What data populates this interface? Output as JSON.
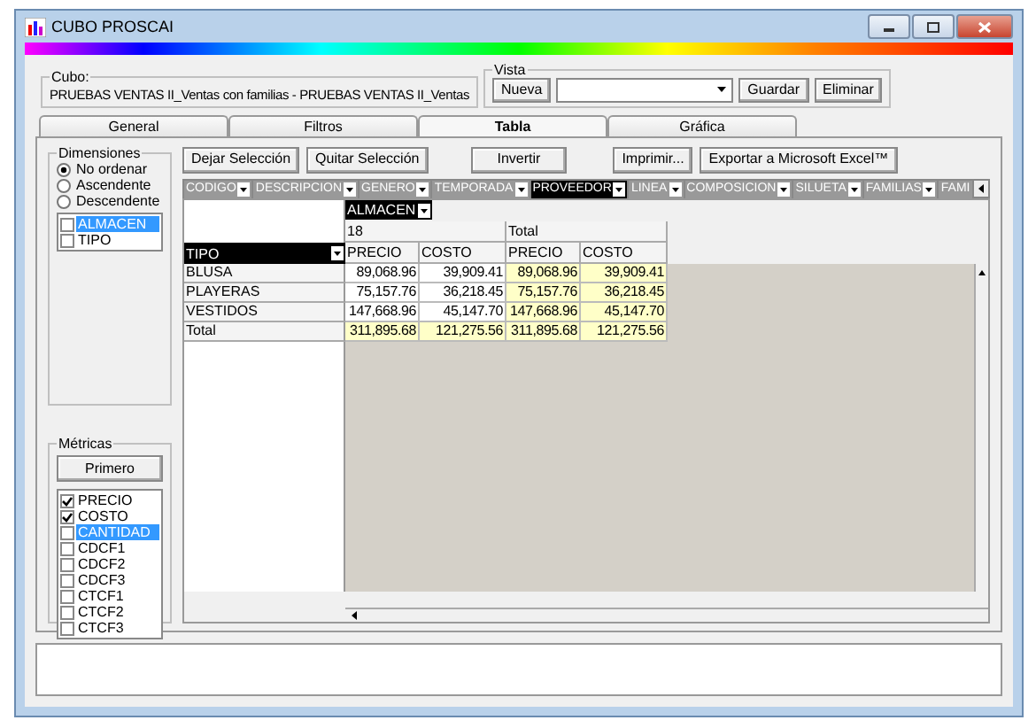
{
  "window": {
    "title": "CUBO PROSCAI"
  },
  "cube": {
    "label": "Cubo:",
    "value": "PRUEBAS VENTAS II_Ventas con familias - PRUEBAS VENTAS II_Ventas"
  },
  "view": {
    "label": "Vista",
    "new_button": "Nueva",
    "save_button": "Guardar",
    "delete_button": "Eliminar"
  },
  "tabs": [
    {
      "label": "General",
      "selected": false
    },
    {
      "label": "Filtros",
      "selected": false
    },
    {
      "label": "Tabla",
      "selected": true
    },
    {
      "label": "Gráfica",
      "selected": false
    }
  ],
  "dimensions": {
    "label": "Dimensiones",
    "sort_options": [
      {
        "label": "No ordenar",
        "selected": true
      },
      {
        "label": "Ascendente",
        "selected": false
      },
      {
        "label": "Descendente",
        "selected": false
      }
    ],
    "items": [
      {
        "label": "ALMACEN",
        "checked": false,
        "selected": true
      },
      {
        "label": "TIPO",
        "checked": false,
        "selected": false
      }
    ]
  },
  "metrics": {
    "label": "Métricas",
    "button": "Primero",
    "items": [
      {
        "label": "PRECIO",
        "checked": true,
        "selected": false
      },
      {
        "label": "COSTO",
        "checked": true,
        "selected": false
      },
      {
        "label": "CANTIDAD",
        "checked": false,
        "selected": true
      },
      {
        "label": "CDCF1",
        "checked": false,
        "selected": false
      },
      {
        "label": "CDCF2",
        "checked": false,
        "selected": false
      },
      {
        "label": "CDCF3",
        "checked": false,
        "selected": false
      },
      {
        "label": "CTCF1",
        "checked": false,
        "selected": false
      },
      {
        "label": "CTCF2",
        "checked": false,
        "selected": false
      },
      {
        "label": "CTCF3",
        "checked": false,
        "selected": false
      }
    ]
  },
  "toolbar": [
    "Dejar Selección",
    "Quitar Selección",
    "Invertir",
    "Imprimir...",
    "Exportar a Microsoft Excel™"
  ],
  "fields": [
    {
      "label": "CODIGO",
      "selected": false
    },
    {
      "label": "DESCRIPCION",
      "selected": false
    },
    {
      "label": "GENERO",
      "selected": false
    },
    {
      "label": "TEMPORADA",
      "selected": false
    },
    {
      "label": "PROVEEDOR",
      "selected": true
    },
    {
      "label": "LINEA",
      "selected": false
    },
    {
      "label": "COMPOSICION",
      "selected": false
    },
    {
      "label": "SILUETA",
      "selected": false
    },
    {
      "label": "FAMILIAS",
      "selected": false
    },
    {
      "label": "FAMI",
      "selected": false
    }
  ],
  "pivot": {
    "column_field": "ALMACEN",
    "row_field": "TIPO",
    "column_groups": [
      "18",
      "Total"
    ],
    "measures": [
      "PRECIO",
      "COSTO",
      "PRECIO",
      "COSTO"
    ],
    "rows": [
      {
        "label": "BLUSA",
        "cells": [
          {
            "value": "89,068.96",
            "highlighted": false
          },
          {
            "value": "39,909.41",
            "highlighted": false
          },
          {
            "value": "89,068.96",
            "highlighted": true
          },
          {
            "value": "39,909.41",
            "highlighted": true
          }
        ]
      },
      {
        "label": "PLAYERAS",
        "cells": [
          {
            "value": "75,157.76",
            "highlighted": false
          },
          {
            "value": "36,218.45",
            "highlighted": false
          },
          {
            "value": "75,157.76",
            "highlighted": true
          },
          {
            "value": "36,218.45",
            "highlighted": true
          }
        ]
      },
      {
        "label": "VESTIDOS",
        "cells": [
          {
            "value": "147,668.96",
            "highlighted": false
          },
          {
            "value": "45,147.70",
            "highlighted": false
          },
          {
            "value": "147,668.96",
            "highlighted": true
          },
          {
            "value": "45,147.70",
            "highlighted": true
          }
        ]
      },
      {
        "label": "Total",
        "cells": [
          {
            "value": "311,895.68",
            "highlighted": true
          },
          {
            "value": "121,275.56",
            "highlighted": true
          },
          {
            "value": "311,895.68",
            "highlighted": true
          },
          {
            "value": "121,275.56",
            "highlighted": true
          }
        ]
      }
    ]
  }
}
